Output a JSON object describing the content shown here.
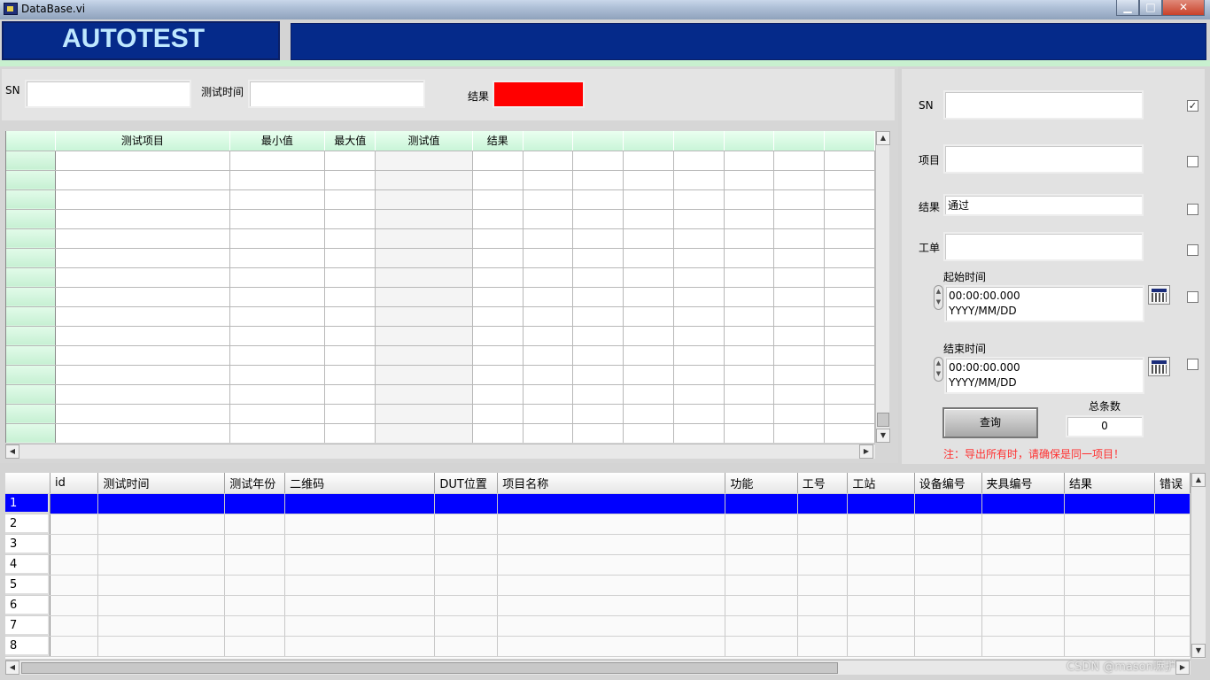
{
  "window": {
    "title": "DataBase.vi",
    "minimize": "▁",
    "maximize": "□",
    "close": "✕"
  },
  "header": {
    "logo_text": "AUTOTEST"
  },
  "top": {
    "sn_label": "SN",
    "sn_value": "",
    "time_label": "测试时间",
    "time_value": "",
    "result_label": "结果",
    "result_color": "#ff0000"
  },
  "test_table": {
    "headers": [
      "",
      "测试项目",
      "最小值",
      "最大值",
      "测试值",
      "结果",
      "",
      "",
      "",
      "",
      "",
      "",
      ""
    ],
    "row_count": 15
  },
  "query": {
    "sn_label": "SN",
    "sn_value": "",
    "sn_checked": true,
    "item_label": "项目",
    "item_value": "",
    "item_checked": false,
    "result_label": "结果",
    "result_value": "通过",
    "result_checked": false,
    "order_label": "工单",
    "order_value": "",
    "order_checked": false,
    "start_label": "起始时间",
    "start_time": "00:00:00.000",
    "start_date": "YYYY/MM/DD",
    "start_checked": false,
    "end_label": "结束时间",
    "end_time": "00:00:00.000",
    "end_date": "YYYY/MM/DD",
    "end_checked": false,
    "query_button": "查询",
    "total_label": "总条数",
    "total_value": "0",
    "note": "注：导出所有时，请确保是同一项目！"
  },
  "result_table": {
    "headers": [
      "",
      "id",
      "测试时间",
      "测试年份",
      "二维码",
      "DUT位置",
      "项目名称",
      "功能",
      "工号",
      "工站",
      "设备编号",
      "夹具编号",
      "结果",
      "错误"
    ],
    "rows": [
      "1",
      "2",
      "3",
      "4",
      "5",
      "6",
      "7",
      "8"
    ],
    "selected_row": 0
  },
  "watermark": "CSDN @mason嘛护"
}
